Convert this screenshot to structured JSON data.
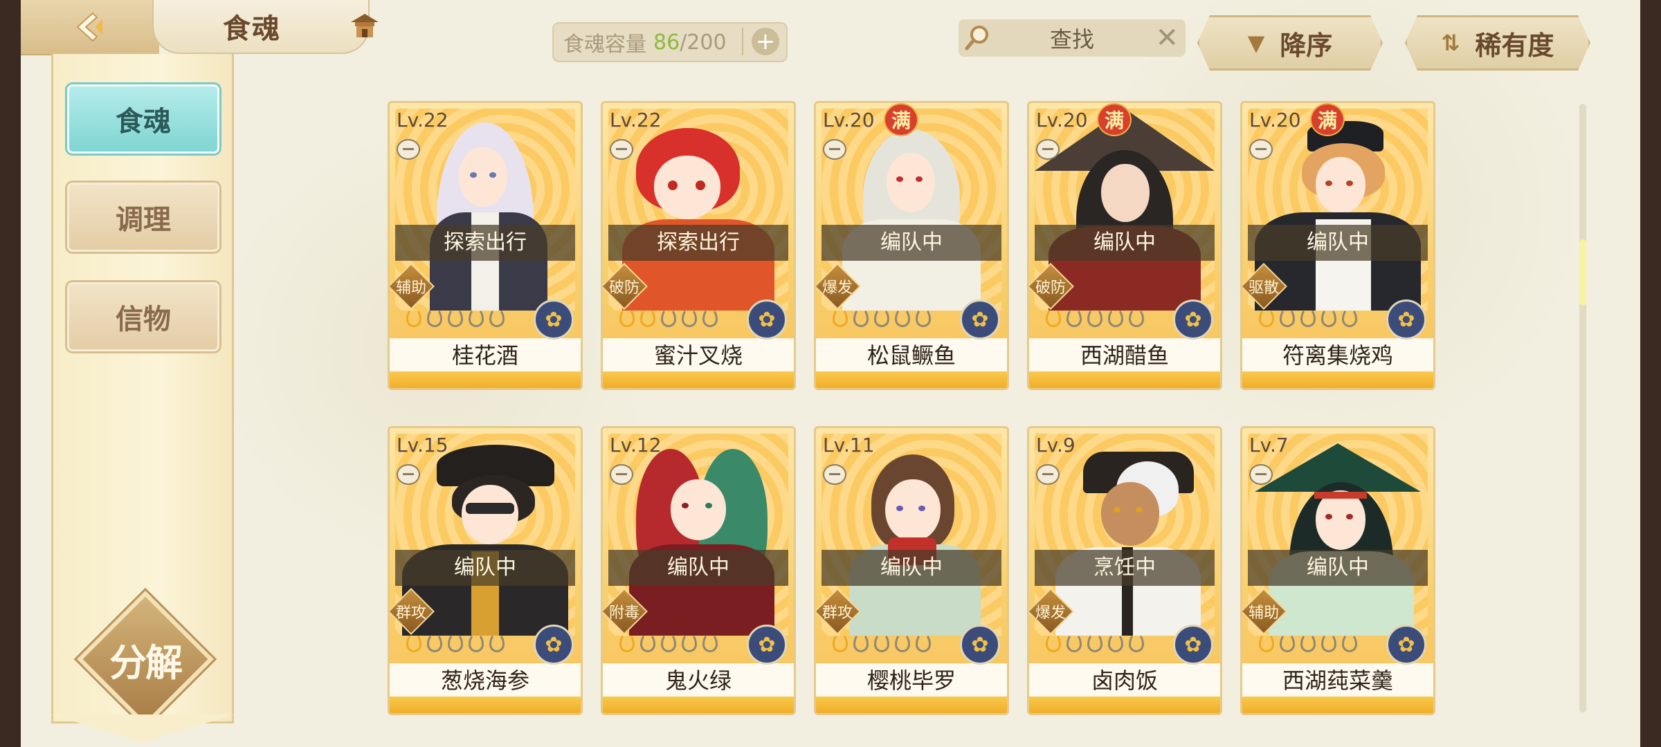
{
  "header": {
    "title": "食魂",
    "capacity_label": "食魂容量",
    "capacity_current": "86",
    "capacity_sep": "/",
    "capacity_max": "200",
    "search_text": "查找",
    "sort_order_label": "降序",
    "sort_key_label": "稀有度"
  },
  "sidebar": {
    "items": [
      {
        "label": "食魂"
      },
      {
        "label": "调理"
      },
      {
        "label": "信物"
      }
    ],
    "decompose_label": "分解"
  },
  "colors": {
    "accent_teal": "#7fd5d2",
    "card_gold": "#f9cf6c",
    "capacity_green": "#8db93e",
    "full_badge_red": "#d8402e"
  },
  "cards": [
    {
      "level": "Lv.22",
      "status": "探索出行",
      "role": "辅助",
      "name": "桂花酒",
      "full": "",
      "stars_on": 1
    },
    {
      "level": "Lv.22",
      "status": "探索出行",
      "role": "破防",
      "name": "蜜汁叉烧",
      "full": "",
      "stars_on": 2
    },
    {
      "level": "Lv.20",
      "status": "编队中",
      "role": "爆发",
      "name": "松鼠鳜鱼",
      "full": "满",
      "stars_on": 1
    },
    {
      "level": "Lv.20",
      "status": "编队中",
      "role": "破防",
      "name": "西湖醋鱼",
      "full": "满",
      "stars_on": 1
    },
    {
      "level": "Lv.20",
      "status": "编队中",
      "role": "驱散",
      "name": "符离集烧鸡",
      "full": "满",
      "stars_on": 1
    },
    {
      "level": "Lv.15",
      "status": "编队中",
      "role": "群攻",
      "name": "葱烧海参",
      "full": "",
      "stars_on": 1
    },
    {
      "level": "Lv.12",
      "status": "编队中",
      "role": "附毒",
      "name": "鬼火绿",
      "full": "",
      "stars_on": 1
    },
    {
      "level": "Lv.11",
      "status": "编队中",
      "role": "群攻",
      "name": "樱桃毕罗",
      "full": "",
      "stars_on": 1
    },
    {
      "level": "Lv.9",
      "status": "烹饪中",
      "role": "爆发",
      "name": "卤肉饭",
      "full": "",
      "stars_on": 1
    },
    {
      "level": "Lv.7",
      "status": "编队中",
      "role": "辅助",
      "name": "西湖莼菜羹",
      "full": "",
      "stars_on": 1
    }
  ]
}
